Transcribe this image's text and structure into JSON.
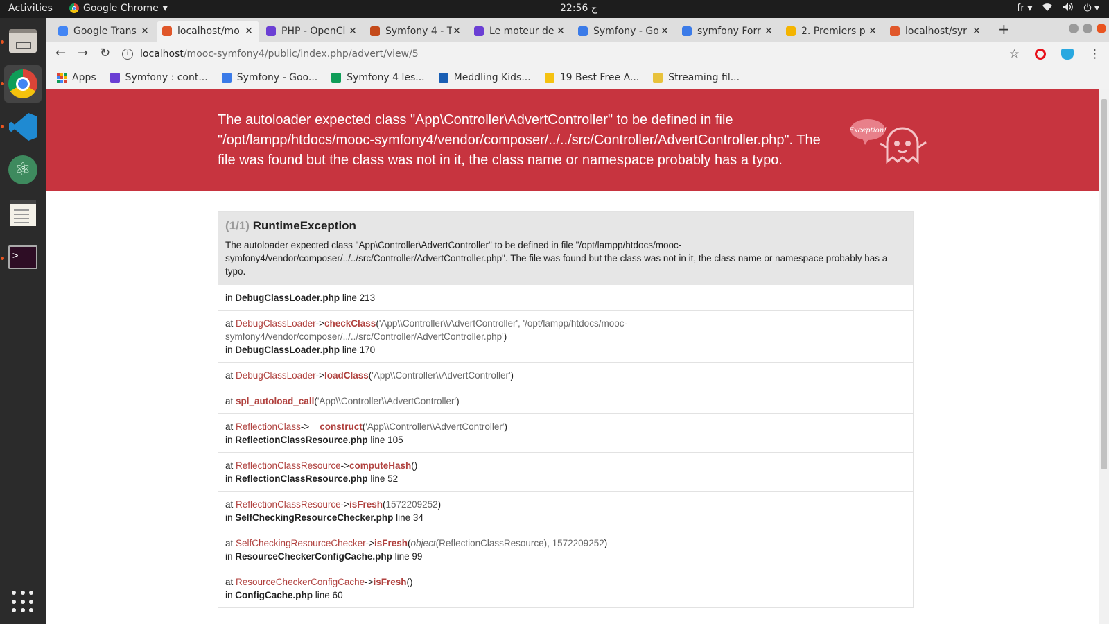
{
  "topbar": {
    "activities": "Activities",
    "app_name": "Google Chrome",
    "clock": "22:56 ج",
    "lang": "fr"
  },
  "tabs": [
    {
      "title": "Google Trans",
      "icon_color": "#4285f4"
    },
    {
      "title": "localhost/mo",
      "icon_color": "#e0572a"
    },
    {
      "title": "PHP - OpenCl",
      "icon_color": "#6b3fd4"
    },
    {
      "title": "Symfony 4 - T",
      "icon_color": "#c44a1a"
    },
    {
      "title": "Le moteur de",
      "icon_color": "#6b3fd4"
    },
    {
      "title": "Symfony - Go",
      "icon_color": "#3b7be8"
    },
    {
      "title": "symfony Forr",
      "icon_color": "#3b7be8"
    },
    {
      "title": "2. Premiers p",
      "icon_color": "#f4b400"
    },
    {
      "title": "localhost/syr",
      "icon_color": "#e0572a"
    }
  ],
  "address": {
    "host": "localhost",
    "path": "/mooc-symfony4/public/index.php/advert/view/5"
  },
  "bookmarks": [
    {
      "label": "Apps"
    },
    {
      "label": "Symfony : cont...",
      "icon_color": "#6b3fd4"
    },
    {
      "label": "Symfony - Goo...",
      "icon_color": "#3b7be8"
    },
    {
      "label": "Symfony 4 les...",
      "icon_color": "#0f9d58"
    },
    {
      "label": "Meddling Kids...",
      "icon_color": "#1a5fb4"
    },
    {
      "label": "19 Best Free A...",
      "icon_color": "#f5c211"
    },
    {
      "label": "Streaming fil...",
      "icon_color": "#e8c23c"
    }
  ],
  "banner": {
    "message": "The autoloader expected class \"App\\Controller\\AdvertController\" to be defined in file \"/opt/lampp/htdocs/mooc-symfony4/vendor/composer/../../src/Controller/AdvertController.php\". The file was found but the class was not in it, the class name or namespace probably has a typo.",
    "ghost_text": "Exception!"
  },
  "exception": {
    "count": "(1/1)",
    "title": "RuntimeException",
    "message": "The autoloader expected class \"App\\Controller\\AdvertController\" to be defined in file \"/opt/lampp/htdocs/mooc-symfony4/vendor/composer/../../src/Controller/AdvertController.php\". The file was found but the class was not in it, the class name or namespace probably has a typo.",
    "first_in": {
      "prefix": "in",
      "file": "DebugClassLoader.php",
      "line": "line 213"
    },
    "frames": [
      {
        "at": "at",
        "cls": "DebugClassLoader",
        "arrow": "->",
        "fn": "checkClass",
        "args": "'App\\\\Controller\\\\AdvertController', '/opt/lampp/htdocs/mooc-symfony4/vendor/composer/../../src/Controller/AdvertController.php'",
        "args_italic": "",
        "file": "DebugClassLoader.php",
        "line": "line 170"
      },
      {
        "at": "at",
        "cls": "DebugClassLoader",
        "arrow": "->",
        "fn": "loadClass",
        "args": "'App\\\\Controller\\\\AdvertController'",
        "args_italic": "",
        "file": "",
        "line": ""
      },
      {
        "at": "at",
        "cls": "",
        "arrow": "",
        "fn": "spl_autoload_call",
        "args": "'App\\\\Controller\\\\AdvertController'",
        "args_italic": "",
        "file": "",
        "line": ""
      },
      {
        "at": "at",
        "cls": "ReflectionClass",
        "arrow": "->",
        "fn": "__construct",
        "args": "'App\\\\Controller\\\\AdvertController'",
        "args_italic": "",
        "file": "ReflectionClassResource.php",
        "line": "line 105"
      },
      {
        "at": "at",
        "cls": "ReflectionClassResource",
        "arrow": "->",
        "fn": "computeHash",
        "args": "",
        "args_italic": "",
        "file": "ReflectionClassResource.php",
        "line": "line 52"
      },
      {
        "at": "at",
        "cls": "ReflectionClassResource",
        "arrow": "->",
        "fn": "isFresh",
        "args": "1572209252",
        "args_italic": "",
        "file": "SelfCheckingResourceChecker.php",
        "line": "line 34"
      },
      {
        "at": "at",
        "cls": "SelfCheckingResourceChecker",
        "arrow": "->",
        "fn": "isFresh",
        "args": "(ReflectionClassResource), 1572209252",
        "args_italic": "object",
        "file": "ResourceCheckerConfigCache.php",
        "line": "line 99"
      },
      {
        "at": "at",
        "cls": "ResourceCheckerConfigCache",
        "arrow": "->",
        "fn": "isFresh",
        "args": "",
        "args_italic": "",
        "file": "ConfigCache.php",
        "line": "line 60"
      }
    ]
  }
}
